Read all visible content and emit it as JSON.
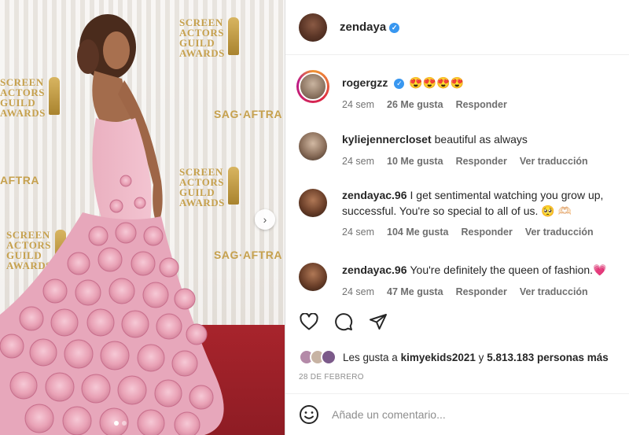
{
  "post": {
    "author": "zendaya",
    "verified_mark": "✓"
  },
  "photo_logos": {
    "screen_actors_guild_awards": "SCREEN ACTORS GUILD AWARDS",
    "sag_aftra": "SAG·AFTRA",
    "aftra_partial": "AFTRA"
  },
  "comments": [
    {
      "user": "rogergzz",
      "verified": true,
      "text": "😍😍😍😍",
      "time": "24 sem",
      "likes": "26 Me gusta",
      "reply": "Responder",
      "translate": ""
    },
    {
      "user": "kyliejennercloset",
      "verified": false,
      "text": "beautiful as always",
      "time": "24 sem",
      "likes": "10 Me gusta",
      "reply": "Responder",
      "translate": "Ver traducción"
    },
    {
      "user": "zendayac.96",
      "verified": false,
      "text": "I get sentimental watching you grow up, successful. You're so special to all of us. 🥺 🫶🏻",
      "time": "24 sem",
      "likes": "104 Me gusta",
      "reply": "Responder",
      "translate": "Ver traducción"
    },
    {
      "user": "zendayac.96",
      "verified": false,
      "text": "You're definitely the queen of fashion.💗",
      "time": "24 sem",
      "likes": "47 Me gusta",
      "reply": "Responder",
      "translate": "Ver traducción"
    }
  ],
  "actions": {
    "like_icon": "heart-icon",
    "comment_icon": "comment-bubble-icon",
    "share_icon": "paper-plane-icon"
  },
  "likes_summary": {
    "prefix": "Les gusta a",
    "user": "kimyekids2021",
    "joiner": "y",
    "count": "5.813.183 personas más"
  },
  "date": "28 DE FEBRERO",
  "composer": {
    "placeholder": "Añade un comentario...",
    "emoji_icon": "smiley-icon"
  },
  "colors": {
    "accent_blue": "#3897f0",
    "heart_pink": "#e0457b",
    "carpet_red": "#a8242c",
    "gold": "#c6a14e"
  }
}
